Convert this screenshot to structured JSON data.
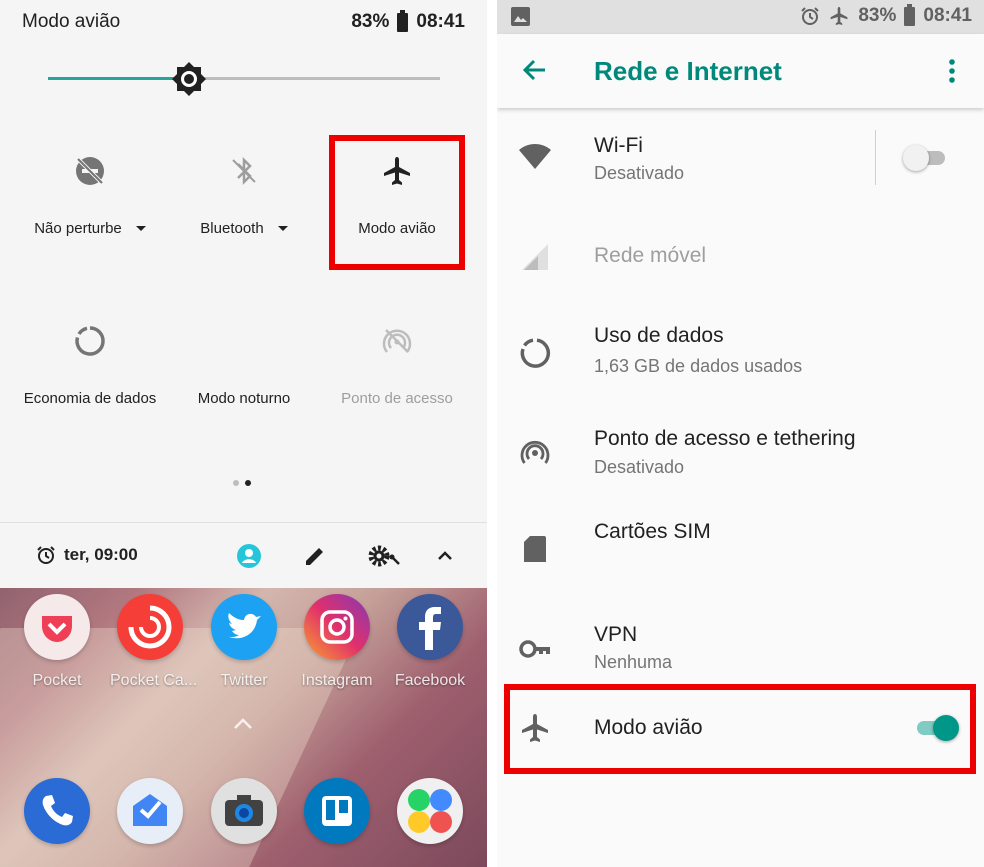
{
  "quick_settings": {
    "status": {
      "title": "Modo avião",
      "battery": "83%",
      "time": "08:41"
    },
    "brightness": {
      "level_fraction": 0.36
    },
    "tiles": [
      {
        "label": "Não perturbe",
        "icon": "do-not-disturb-off-icon",
        "has_dropdown": true
      },
      {
        "label": "Bluetooth",
        "icon": "bluetooth-off-icon",
        "has_dropdown": true
      },
      {
        "label": "Modo avião",
        "icon": "airplane-icon",
        "has_dropdown": false
      },
      {
        "label": "Economia de dados",
        "icon": "data-saver-icon",
        "has_dropdown": false
      },
      {
        "label": "Modo noturno",
        "icon": "moon-icon",
        "has_dropdown": false
      },
      {
        "label": "Ponto de acesso",
        "icon": "hotspot-off-icon",
        "has_dropdown": false
      }
    ],
    "page_indicator": {
      "pages": 2,
      "current": 2
    },
    "footer": {
      "alarm_text": "ter, 09:00"
    },
    "accent_color": "#26a69a",
    "highlight_color": "#ee0000"
  },
  "home_screen": {
    "apps": [
      {
        "name": "Pocket",
        "color": "#ef3f56"
      },
      {
        "name": "Pocket Ca...",
        "color": "#f43e37"
      },
      {
        "name": "Twitter",
        "color": "#1da1f2"
      },
      {
        "name": "Instagram",
        "color": "#c13584"
      },
      {
        "name": "Facebook",
        "color": "#3b5998"
      }
    ],
    "dock": [
      {
        "name": "phone",
        "icon": "phone-icon",
        "color": "#2b6bd6"
      },
      {
        "name": "inbox",
        "icon": "inbox-icon",
        "color": "#e8eef7"
      },
      {
        "name": "camera",
        "icon": "camera-icon",
        "color": "#444444"
      },
      {
        "name": "trello",
        "icon": "trello-icon",
        "color": "#0079bf"
      },
      {
        "name": "social-folder",
        "icon": "folder-icon",
        "color": "#f0f0f0"
      }
    ]
  },
  "settings": {
    "status": {
      "battery": "83%",
      "time": "08:41"
    },
    "title": "Rede e Internet",
    "items": [
      {
        "title": "Wi-Fi",
        "subtitle": "Desativado",
        "icon": "wifi-icon",
        "toggle": false
      },
      {
        "title": "Rede móvel",
        "subtitle": "",
        "icon": "cell-signal-icon",
        "disabled": true
      },
      {
        "title": "Uso de dados",
        "subtitle": "1,63 GB de dados usados",
        "icon": "data-usage-icon"
      },
      {
        "title": "Ponto de acesso e tethering",
        "subtitle": "Desativado",
        "icon": "hotspot-icon"
      },
      {
        "title": "Cartões SIM",
        "subtitle": "",
        "icon": "sim-card-icon"
      },
      {
        "title": "VPN",
        "subtitle": "Nenhuma",
        "icon": "vpn-key-icon"
      },
      {
        "title": "Modo avião",
        "subtitle": "",
        "icon": "airplane-icon",
        "toggle": true
      }
    ],
    "accent_color": "#00897b"
  }
}
